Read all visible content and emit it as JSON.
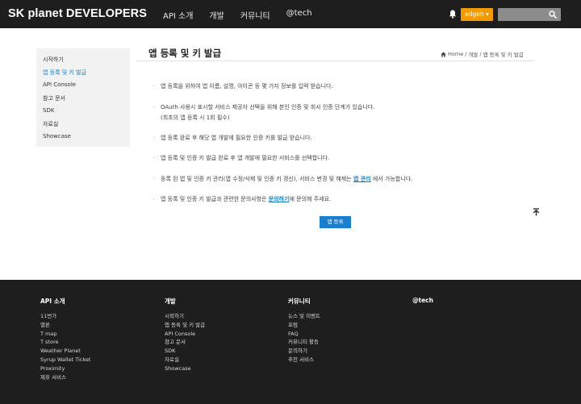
{
  "header": {
    "logo": "SK planet DEVELOPERS",
    "nav": [
      "API 소개",
      "개발",
      "커뮤니티",
      "@tech"
    ],
    "user_label": "edgeh ▾",
    "search_placeholder": "",
    "accent_color": "#f29a00"
  },
  "sidebar": {
    "items": [
      "시작하기",
      "앱 등록 및 키 발급",
      "API Console",
      "참고 문서",
      "SDK",
      "자료실",
      "Showcase"
    ],
    "active_index": 1
  },
  "main": {
    "title": "앱 등록 및 키 발급",
    "breadcrumb": [
      "Home",
      "개발",
      "앱 등록 및 키 발급"
    ],
    "bullets": [
      {
        "text": "앱 등록을 위하여 앱 이름, 설명, 아이콘 등 몇 가지 정보를 입력 받습니다."
      },
      {
        "text": "OAuth 사용시 표시할 서비스 제공자 선택을 위해 본인 인증 및 회사 인증 단계가 있습니다.",
        "sub": "(최초의 앱 등록 시 1회 필수)"
      },
      {
        "text": "앱 등록 완료 후 해당 앱 개발에 필요한 인증 키를 발급 받습니다."
      },
      {
        "text": "앱 등록 및 인증 키 발급 완료 후 앱 개발에 필요한 서비스를 선택합니다."
      },
      {
        "pre": "등록 된 앱 및 인증 키 관리(앱 수정/삭제 및 인증 키 갱신), 서비스 변경 및 해제는 ",
        "link": "앱 관리",
        "post": " 에서 가능합니다."
      },
      {
        "pre": "앱 등록 및 인증 키 발급과 관련한 문의사항은 ",
        "link": "문의하기",
        "post": "에 문의해 주세요."
      }
    ],
    "register_button": "앱 등록",
    "button_color": "#1b7fd0"
  },
  "footer": {
    "columns": [
      {
        "title": "API 소개",
        "links": [
          "11번가",
          "멜론",
          "T map",
          "T store",
          "Weather Planet",
          "Syrup Wallet Ticket",
          "Proximity",
          "제휴 서비스"
        ]
      },
      {
        "title": "개발",
        "links": [
          "시작하기",
          "앱 등록 및 키 발급",
          "API Console",
          "참고 문서",
          "SDK",
          "자료실",
          "Showcase"
        ]
      },
      {
        "title": "커뮤니티",
        "links": [
          "뉴스 및 이벤트",
          "포럼",
          "FAQ",
          "커뮤니티 활동",
          "문의하기",
          "추천 서비스"
        ]
      },
      {
        "title": "@tech",
        "links": []
      }
    ]
  }
}
